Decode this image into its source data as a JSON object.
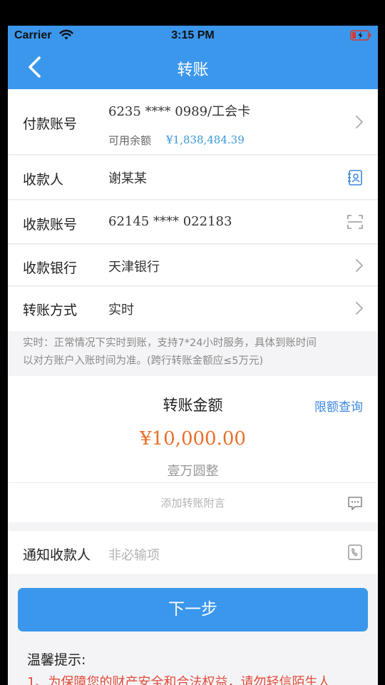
{
  "status_bar": {
    "carrier": "Carrier",
    "time": "3:15 PM"
  },
  "navbar": {
    "title": "转账",
    "back_icon": "chevron-left-icon"
  },
  "payer_account": {
    "label": "付款账号",
    "account": "6235 **** 0989/工会卡",
    "balance_label": "可用余额",
    "balance_value": "¥1,838,484.39"
  },
  "payee": {
    "label": "收款人",
    "value": "谢某某",
    "icon": "contacts-book-icon"
  },
  "payee_account": {
    "label": "收款账号",
    "value": "62145 **** 022183",
    "icon": "scan-icon"
  },
  "payee_bank": {
    "label": "收款银行",
    "value": "天津银行"
  },
  "transfer_method": {
    "label": "转账方式",
    "value": "实时"
  },
  "note": {
    "line1": "实时：正常情况下实时到账，支持7*24小时服务，具体到账时间",
    "line2": "以对方账户入账时间为准。(跨行转账金额应≤5万元)"
  },
  "amount": {
    "title": "转账金额",
    "limit_link": "限额查询",
    "value": "¥10,000.00",
    "in_words": "壹万圆整"
  },
  "memo": {
    "placeholder": "添加转账附言",
    "icon": "chat-bubble-icon"
  },
  "notify": {
    "label": "通知收款人",
    "placeholder": "非必输项",
    "icon": "phone-book-icon"
  },
  "next_button": {
    "label": "下一步"
  },
  "tips": {
    "title": "温馨提示:",
    "line1": "1、为保障您的财产安全和合法权益，请勿轻信陌生人"
  },
  "colors": {
    "primary": "#3b97ec",
    "amount": "#e8702a",
    "link": "#3b87e0",
    "warning": "#e24b3a",
    "balance": "#3a9ad9"
  }
}
